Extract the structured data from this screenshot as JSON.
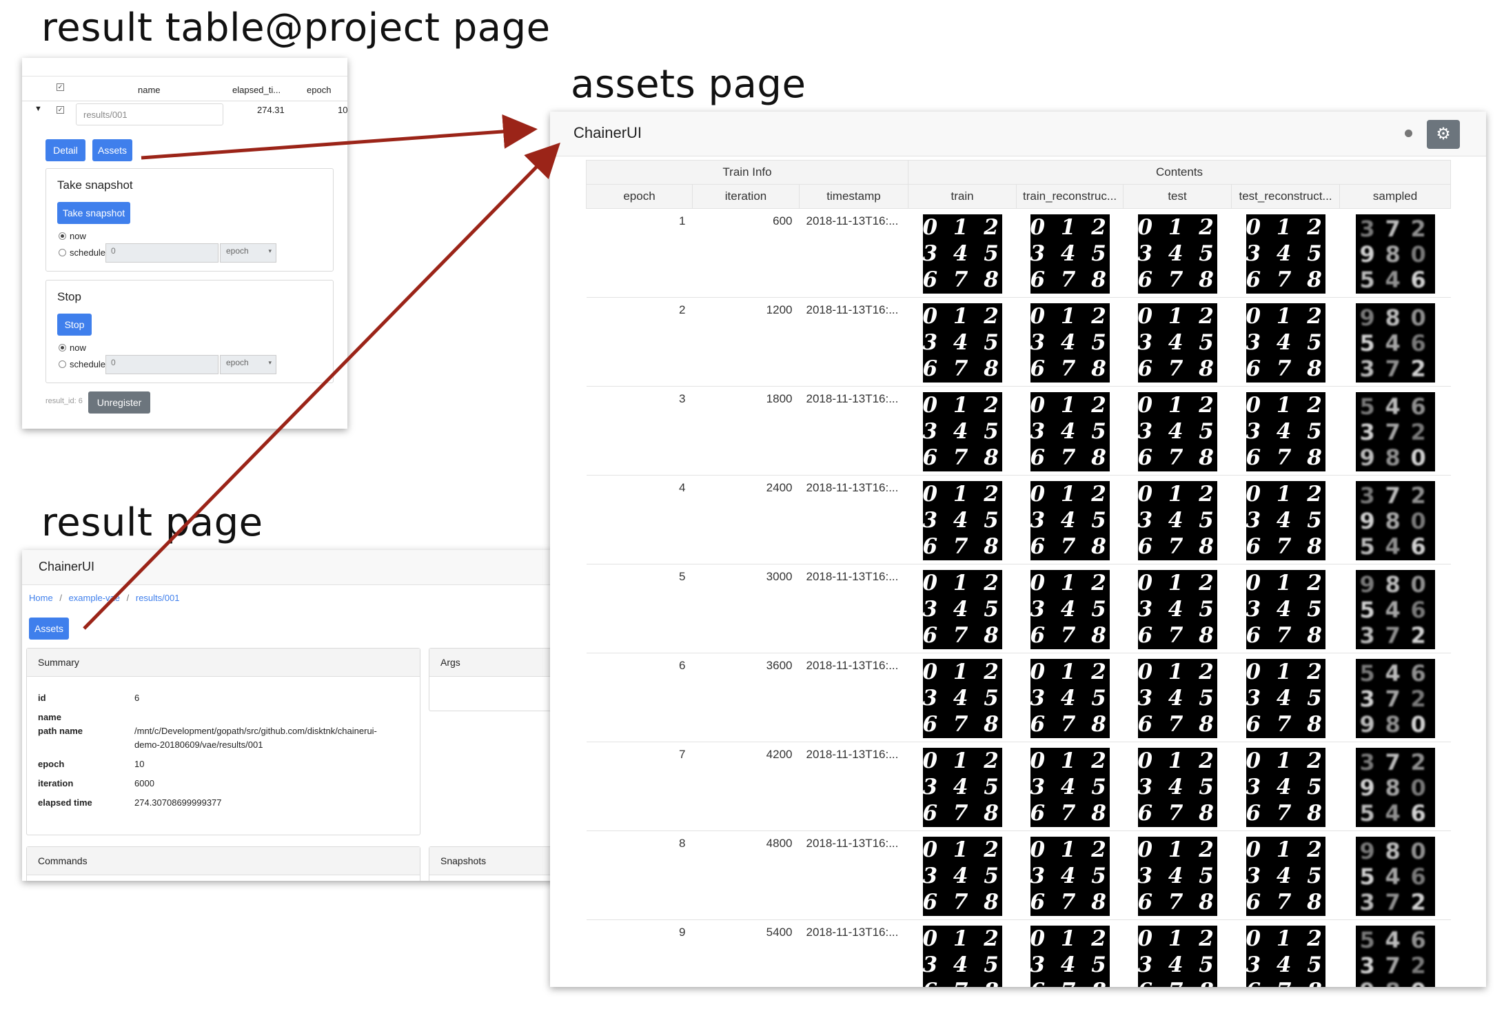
{
  "captions": {
    "project": "result table@project page",
    "assets": "assets page",
    "result": "result page"
  },
  "project_panel": {
    "columns": [
      "name",
      "elapsed_ti...",
      "epoch"
    ],
    "row": {
      "name": "results/001",
      "elapsed": "274.31",
      "epoch": "10"
    },
    "buttons": {
      "detail": "Detail",
      "assets": "Assets"
    },
    "take_snapshot": {
      "title": "Take snapshot",
      "button": "Take snapshot",
      "now": "now",
      "schedule": "schedule",
      "value": "0",
      "unit": "epoch"
    },
    "stop": {
      "title": "Stop",
      "button": "Stop",
      "now": "now",
      "schedule": "schedule",
      "value": "0",
      "unit": "epoch"
    },
    "result_id": "result_id: 6",
    "unregister": "Unregister"
  },
  "result_panel": {
    "app_title": "ChainerUI",
    "breadcrumb": [
      "Home",
      "example-vae",
      "results/001"
    ],
    "breadcrumb_sep": "/",
    "assets_button": "Assets",
    "summary": {
      "title": "Summary",
      "rows": [
        {
          "k": "id",
          "v": "6"
        },
        {
          "k": "name",
          "v": ""
        },
        {
          "k": "path name",
          "v": "/mnt/c/Development/gopath/src/github.com/disktnk/chainerui-",
          "v2": "demo-20180609/vae/results/001"
        },
        {
          "k": "epoch",
          "v": "10"
        },
        {
          "k": "iteration",
          "v": "6000"
        },
        {
          "k": "elapsed time",
          "v": "274.30708699999377"
        }
      ]
    },
    "args_title": "Args",
    "commands_title": "Commands",
    "snapshots_title": "Snapshots"
  },
  "assets_panel": {
    "app_title": "ChainerUI",
    "group_headers": {
      "train_info": "Train Info",
      "contents": "Contents"
    },
    "columns": [
      "epoch",
      "iteration",
      "timestamp",
      "train",
      "train_reconstruc...",
      "test",
      "test_reconstruct...",
      "sampled"
    ],
    "rows": [
      {
        "epoch": "1",
        "iteration": "600",
        "timestamp": "2018-11-13T16:..."
      },
      {
        "epoch": "2",
        "iteration": "1200",
        "timestamp": "2018-11-13T16:..."
      },
      {
        "epoch": "3",
        "iteration": "1800",
        "timestamp": "2018-11-13T16:..."
      },
      {
        "epoch": "4",
        "iteration": "2400",
        "timestamp": "2018-11-13T16:..."
      },
      {
        "epoch": "5",
        "iteration": "3000",
        "timestamp": "2018-11-13T16:..."
      },
      {
        "epoch": "6",
        "iteration": "3600",
        "timestamp": "2018-11-13T16:..."
      },
      {
        "epoch": "7",
        "iteration": "4200",
        "timestamp": "2018-11-13T16:..."
      },
      {
        "epoch": "8",
        "iteration": "4800",
        "timestamp": "2018-11-13T16:..."
      },
      {
        "epoch": "9",
        "iteration": "5400",
        "timestamp": "2018-11-13T16:..."
      }
    ],
    "digit_lines": [
      "0 1 2",
      "3 4 5",
      "6 7 8"
    ]
  },
  "colors": {
    "accent": "#3f7fec",
    "arrow": "#9b2418",
    "gray_button": "#6c757d"
  }
}
